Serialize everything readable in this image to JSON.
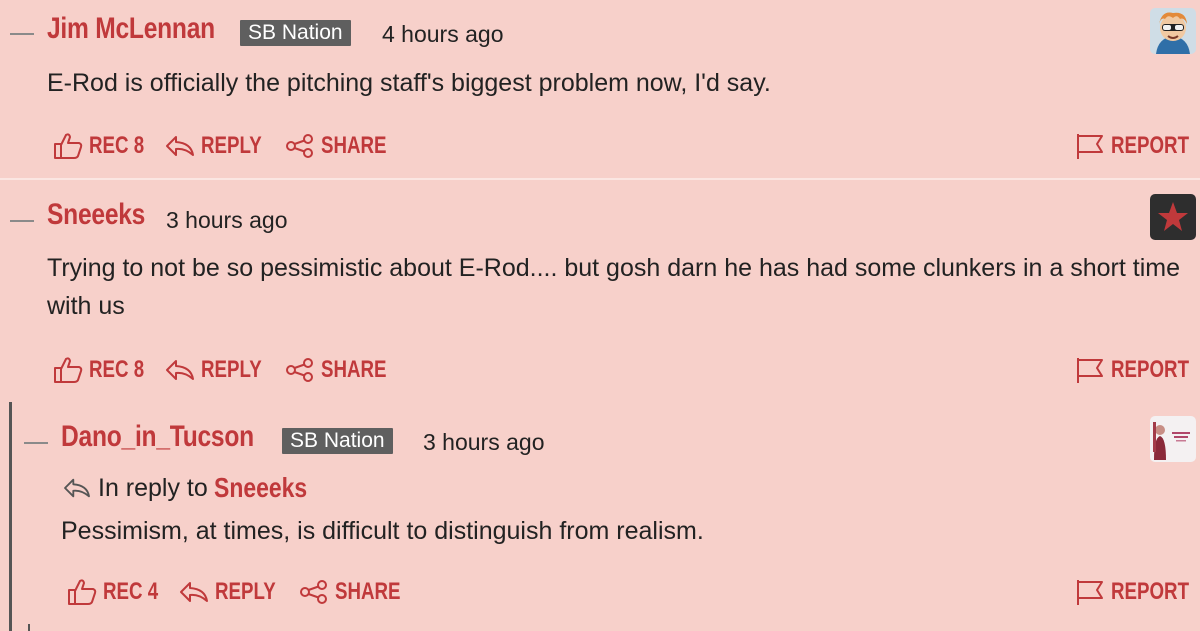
{
  "comments": [
    {
      "author": "Jim McLennan",
      "badge": "SB Nation",
      "time": "4 hours ago",
      "body": "E-Rod is officially the pitching staff's biggest problem now, I'd say.",
      "rec_label": "REC 8",
      "reply_label": "REPLY",
      "share_label": "SHARE",
      "report_label": "REPORT",
      "avatar_icon": "cartoon-avatar-icon"
    },
    {
      "author": "Sneeeks",
      "time": "3 hours ago",
      "body": "Trying to not be so pessimistic about E-Rod.... but gosh darn he has had some clunkers in a short time with us",
      "rec_label": "REC 8",
      "reply_label": "REPLY",
      "share_label": "SHARE",
      "report_label": "REPORT",
      "avatar_icon": "star-icon"
    },
    {
      "author": "Dano_in_Tucson",
      "badge": "SB Nation",
      "time": "3 hours ago",
      "in_reply_prefix": "In reply to",
      "in_reply_to": "Sneeeks",
      "body": "Pessimism, at times, is difficult to distinguish from realism.",
      "rec_label": "REC 4",
      "reply_label": "REPLY",
      "share_label": "SHARE",
      "report_label": "REPORT",
      "avatar_icon": "photo-avatar-icon"
    }
  ],
  "colors": {
    "background": "#f7d0ca",
    "accent": "#c0393b",
    "badge": "#5f5f5f",
    "text": "#222222"
  }
}
